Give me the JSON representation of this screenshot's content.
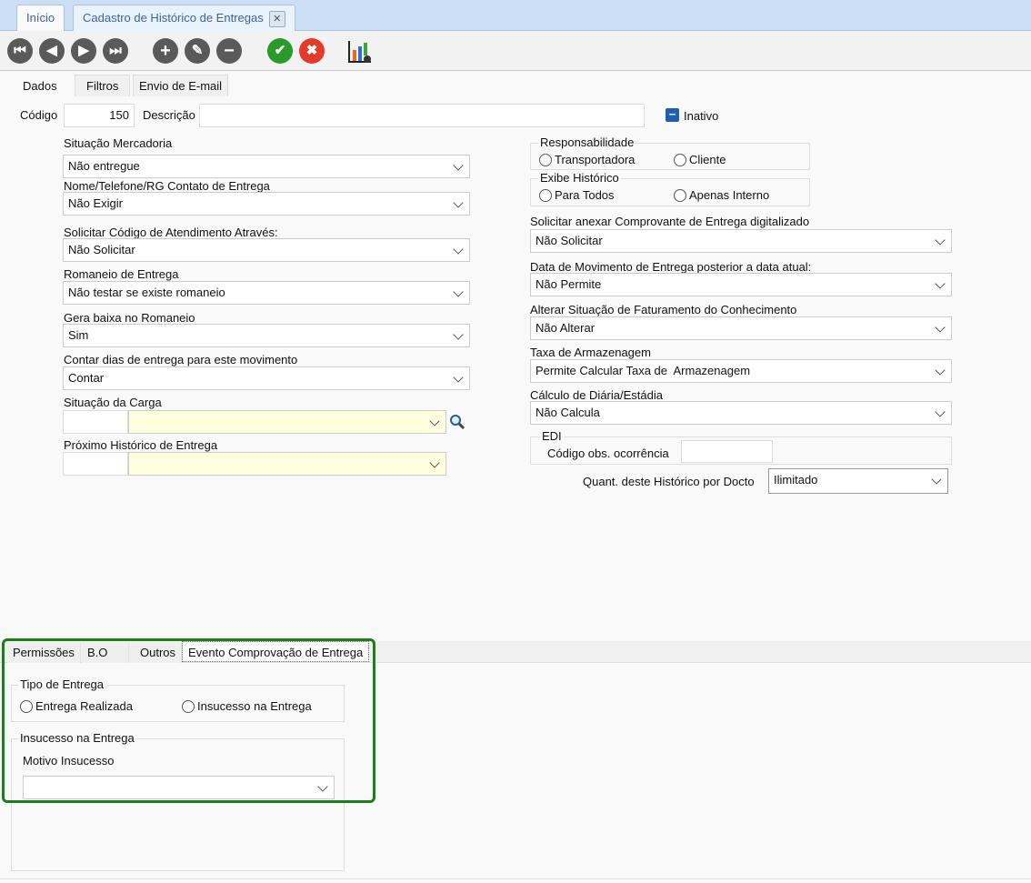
{
  "window_tabs": [
    {
      "label": "Início"
    },
    {
      "label": "Cadastro de Histórico de Entregas"
    }
  ],
  "form_tabs": [
    "Dados",
    "Filtros",
    "Envio de E-mail"
  ],
  "codigo": {
    "label": "Código",
    "value": "150"
  },
  "descricao": {
    "label": "Descrição",
    "value": ""
  },
  "inativo": {
    "label": "Inativo"
  },
  "left": [
    {
      "label": "Situação Mercadoria",
      "value": "Não entregue"
    },
    {
      "label": "Nome/Telefone/RG Contato de Entrega",
      "value": "Não Exigir"
    },
    {
      "label": "Solicitar Código de Atendimento Através:",
      "value": "Não Solicitar"
    },
    {
      "label": "Romaneio de Entrega",
      "value": "Não testar se existe romaneio"
    },
    {
      "label": "Gera baixa no Romaneio",
      "value": "Sim"
    },
    {
      "label": "Contar dias de entrega para este movimento",
      "value": "Contar"
    }
  ],
  "situacao_carga": {
    "label": "Situação da Carga"
  },
  "proximo_historico": {
    "label": "Próximo Histórico de Entrega"
  },
  "responsabilidade": {
    "title": "Responsabilidade",
    "options": [
      "Transportadora",
      "Cliente"
    ]
  },
  "exibe_historico": {
    "title": "Exibe Histórico",
    "options": [
      "Para Todos",
      "Apenas Interno"
    ]
  },
  "right": [
    {
      "label": "Solicitar anexar Comprovante de Entrega digitalizado",
      "value": "Não Solicitar"
    },
    {
      "label": "Data de Movimento de Entrega posterior a data atual:",
      "value": "Não Permite"
    },
    {
      "label": "Alterar Situação de Faturamento do Conhecimento",
      "value": "Não Alterar"
    },
    {
      "label": "Taxa de Armazenagem",
      "value": "Permite Calcular Taxa de  Armazenagem"
    },
    {
      "label": "Cálculo de Diária/Estádia",
      "value": "Não Calcula"
    }
  ],
  "edi": {
    "title": "EDI",
    "codigo_obs_label": "Código obs. ocorrência",
    "codigo_obs_value": ""
  },
  "quant": {
    "label": "Quant. deste Histórico por Docto",
    "value": "Ilimitado"
  },
  "bottom_tabs": [
    "Permissões",
    "B.O",
    "Outros",
    "Evento Comprovação de Entrega"
  ],
  "tipo_entrega": {
    "title": "Tipo de Entrega",
    "options": [
      "Entrega Realizada",
      "Insucesso na Entrega"
    ]
  },
  "insucesso": {
    "title": "Insucesso na Entrega",
    "motivo_label": "Motivo Insucesso",
    "motivo_value": ""
  },
  "colors": {
    "highlight": "#1a7f1a",
    "confirm": "#2a9a2a",
    "cancel": "#e53a2a",
    "checkbox": "#1f5fb0"
  }
}
